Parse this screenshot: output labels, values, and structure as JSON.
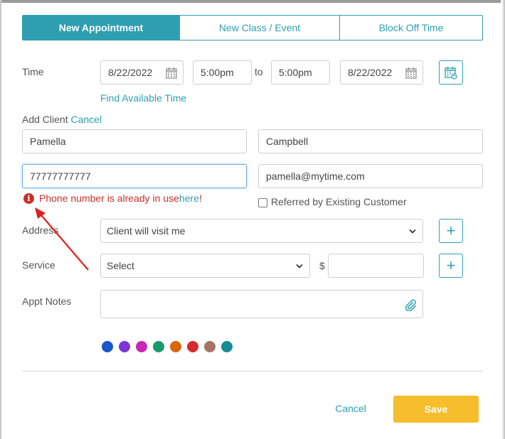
{
  "tabs": [
    {
      "label": "New Appointment",
      "active": true
    },
    {
      "label": "New Class / Event",
      "active": false
    },
    {
      "label": "Block Off Time",
      "active": false
    }
  ],
  "time": {
    "label": "Time",
    "start_date": "8/22/2022",
    "start_time": "5:00pm",
    "to_label": "to",
    "end_time": "5:00pm",
    "end_date": "8/22/2022",
    "find_available": "Find Available Time"
  },
  "client": {
    "label": "Add Client",
    "cancel_link": "Cancel",
    "first_name": "Pamella",
    "last_name": "Campbell",
    "phone": "77777777777",
    "email": "pamella@mytime.com",
    "error_text": "Phone number is already in use ",
    "error_link": "here",
    "error_end": "!",
    "referred_label": "Referred by Existing Customer"
  },
  "address": {
    "label": "Address",
    "selected": "Client will visit me"
  },
  "service": {
    "label": "Service",
    "selected": "Select",
    "currency": "$",
    "price": ""
  },
  "notes": {
    "label": "Appt Notes",
    "value": ""
  },
  "colors": [
    "#1a56c9",
    "#7b35d9",
    "#c728b5",
    "#1a9a6b",
    "#d9650c",
    "#d62b2b",
    "#a87366",
    "#1a8a94"
  ],
  "footer": {
    "cancel": "Cancel",
    "save": "Save"
  },
  "accent": "#2e9fb0",
  "error_color": "#c9302c",
  "save_color": "#f6be2c"
}
